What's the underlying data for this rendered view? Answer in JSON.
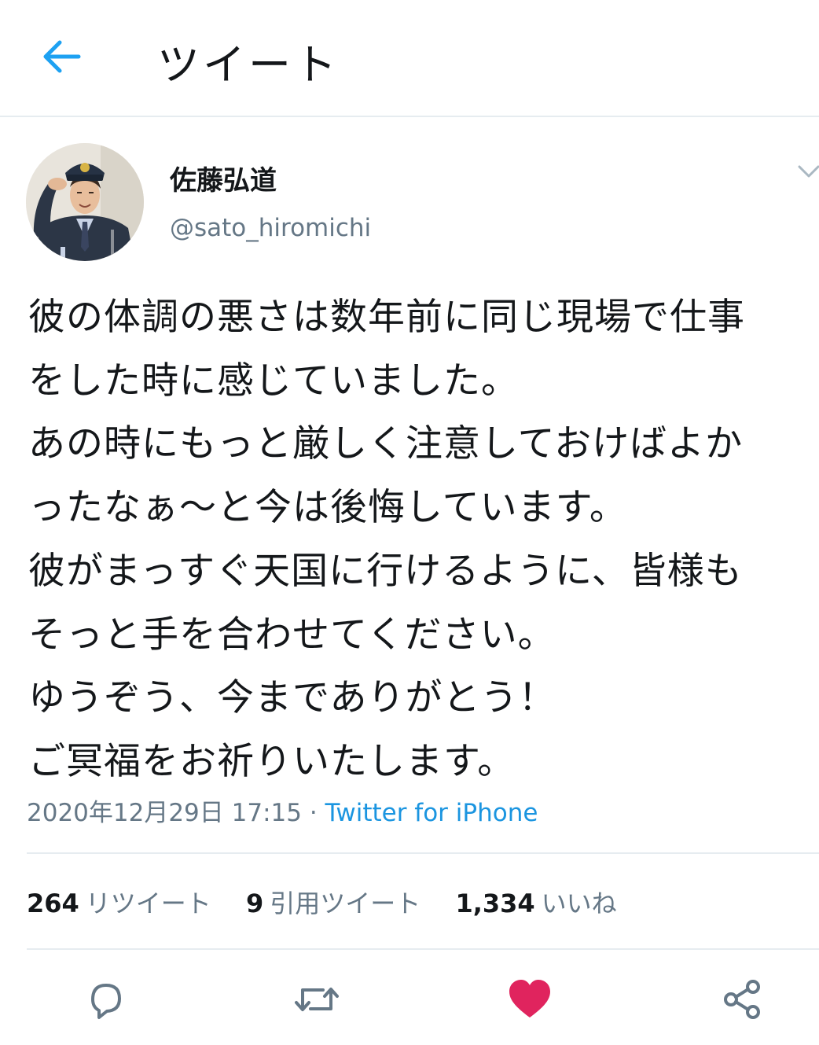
{
  "header": {
    "title": "ツイート",
    "back_icon": "arrow-left-icon"
  },
  "author": {
    "display_name": "佐藤弘道",
    "handle": "@sato_hiromichi",
    "avatar_icon": "avatar-photo"
  },
  "tweet": {
    "lines": [
      "彼の体調の悪さは数年前に同じ現場で仕事",
      "をした時に感じていました。",
      "あの時にもっと厳しく注意しておけばよか",
      "ったなぁ～と今は後悔しています。",
      "彼がまっすぐ天国に行けるように、皆様も",
      "そっと手を合わせてください。",
      "ゆうぞう、今までありがとう！",
      "ご冥福をお祈りいたします。"
    ]
  },
  "meta": {
    "timestamp": "2020年12月29日 17:15",
    "separator": " · ",
    "source": "Twitter for iPhone"
  },
  "stats": {
    "retweets_count": "264",
    "retweets_label": "リツイート",
    "quotes_count": "9",
    "quotes_label": "引用ツイート",
    "likes_count": "1,334",
    "likes_label": "いいね"
  },
  "actions": {
    "reply_icon": "reply-icon",
    "retweet_icon": "retweet-icon",
    "like_icon": "heart-icon",
    "share_icon": "share-icon"
  },
  "colors": {
    "accent": "#1da1f2",
    "link": "#1b95e0",
    "secondary_text": "#657786",
    "divider": "#e6ecf0",
    "like": "#e0245e",
    "action_icon": "#657786"
  }
}
